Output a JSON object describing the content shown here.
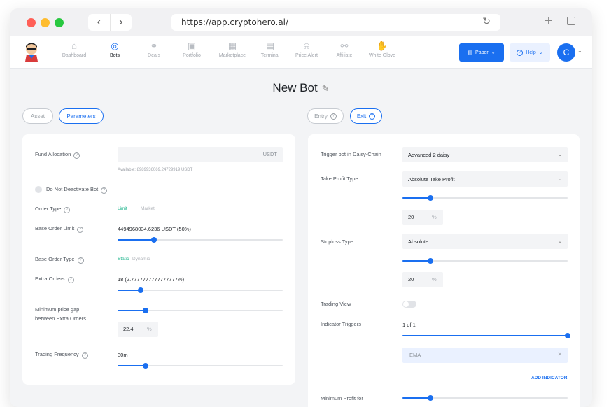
{
  "browser": {
    "url": "https://app.cryptohero.ai/"
  },
  "nav": {
    "items": [
      {
        "label": "Dashboard",
        "icon": "home-icon",
        "glyph": "⌂"
      },
      {
        "label": "Bots",
        "icon": "robot-icon",
        "glyph": "◎"
      },
      {
        "label": "Deals",
        "icon": "handshake-icon",
        "glyph": "⚭"
      },
      {
        "label": "Portfolio",
        "icon": "briefcase-icon",
        "glyph": "▣"
      },
      {
        "label": "Marketplace",
        "icon": "store-icon",
        "glyph": "▦"
      },
      {
        "label": "Terminal",
        "icon": "terminal-icon",
        "glyph": "▤"
      },
      {
        "label": "Price Alert",
        "icon": "bell-icon",
        "glyph": "⍾"
      },
      {
        "label": "Affiliate",
        "icon": "share-icon",
        "glyph": "⚯"
      },
      {
        "label": "White Glove",
        "icon": "glove-icon",
        "glyph": "✋"
      }
    ],
    "active": "Bots",
    "paper_label": "Paper",
    "help_label": "Help",
    "avatar_initial": "C"
  },
  "page": {
    "title": "New Bot",
    "left_tabs": [
      "Asset",
      "Parameters"
    ],
    "right_tabs": [
      "Entry",
      "Exit"
    ]
  },
  "left": {
    "fund_allocation": {
      "label": "Fund Allocation",
      "unit": "USDT",
      "available": "Available: 8989936069.24729919 USDT"
    },
    "do_not_deactivate": "Do Not Deactivate Bot",
    "order_type": {
      "label": "Order Type",
      "options": [
        "Limit",
        "Market"
      ]
    },
    "base_order_limit": {
      "label": "Base Order Limit",
      "value": "4494968034.6236 USDT (50%)",
      "level": 0.22
    },
    "base_order_type": {
      "label": "Base Order Type",
      "options": [
        "Static",
        "Dynamic"
      ]
    },
    "extra_orders": {
      "label": "Extra Orders",
      "value": "18 (2.7777777777777777%)",
      "level": 0.14
    },
    "min_price_gap": {
      "label_line1": "Minimum price gap",
      "label_line2": "between Extra Orders",
      "value": "22.4",
      "unit": "%",
      "level": 0.17
    },
    "trading_frequency": {
      "label": "Trading Frequency",
      "value": "30m",
      "level": 0.17
    }
  },
  "right": {
    "daisy_chain": {
      "label": "Trigger bot in Daisy-Chain",
      "value": "Advanced 2 daisy"
    },
    "take_profit": {
      "label": "Take Profit Type",
      "value": "Absolute Take Profit",
      "level": 0.17,
      "amount": "20",
      "unit": "%"
    },
    "stoploss": {
      "label": "Stoploss Type",
      "value": "Absolute",
      "level": 0.17,
      "amount": "20",
      "unit": "%"
    },
    "trading_view": {
      "label": "Trading View"
    },
    "indicator_triggers": {
      "label": "Indicator Triggers",
      "value": "1 of 1",
      "level": 1.0,
      "indicator": "EMA"
    },
    "add_indicator": "ADD INDICATOR",
    "min_profit": {
      "label": "Minimum Profit for",
      "level": 0.17
    }
  }
}
